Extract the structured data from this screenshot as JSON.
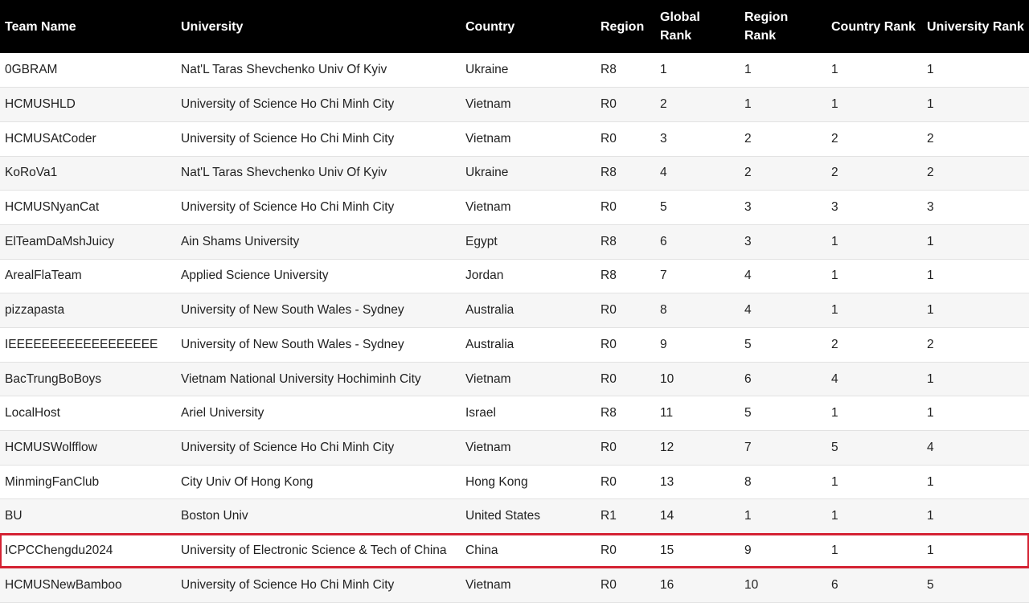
{
  "columns": {
    "team_name": "Team Name",
    "university": "University",
    "country": "Country",
    "region": "Region",
    "global_rank": "Global Rank",
    "region_rank": "Region Rank",
    "country_rank": "Country Rank",
    "university_rank": "University Rank"
  },
  "highlight_color": "#d42233",
  "highlighted_row_index": 14,
  "rows": [
    {
      "team": "0GBRAM",
      "university": "Nat'L Taras Shevchenko Univ Of Kyiv",
      "country": "Ukraine",
      "region": "R8",
      "global_rank": "1",
      "region_rank": "1",
      "country_rank": "1",
      "university_rank": "1"
    },
    {
      "team": "HCMUSHLD",
      "university": "University of Science Ho Chi Minh City",
      "country": "Vietnam",
      "region": "R0",
      "global_rank": "2",
      "region_rank": "1",
      "country_rank": "1",
      "university_rank": "1"
    },
    {
      "team": "HCMUSAtCoder",
      "university": "University of Science Ho Chi Minh City",
      "country": "Vietnam",
      "region": "R0",
      "global_rank": "3",
      "region_rank": "2",
      "country_rank": "2",
      "university_rank": "2"
    },
    {
      "team": "KoRoVa1",
      "university": "Nat'L Taras Shevchenko Univ Of Kyiv",
      "country": "Ukraine",
      "region": "R8",
      "global_rank": "4",
      "region_rank": "2",
      "country_rank": "2",
      "university_rank": "2"
    },
    {
      "team": "HCMUSNyanCat",
      "university": "University of Science Ho Chi Minh City",
      "country": "Vietnam",
      "region": "R0",
      "global_rank": "5",
      "region_rank": "3",
      "country_rank": "3",
      "university_rank": "3"
    },
    {
      "team": "ElTeamDaMshJuicy",
      "university": "Ain Shams University",
      "country": "Egypt",
      "region": "R8",
      "global_rank": "6",
      "region_rank": "3",
      "country_rank": "1",
      "university_rank": "1"
    },
    {
      "team": "ArealFlaTeam",
      "university": "Applied Science University",
      "country": "Jordan",
      "region": "R8",
      "global_rank": "7",
      "region_rank": "4",
      "country_rank": "1",
      "university_rank": "1"
    },
    {
      "team": "pizzapasta",
      "university": "University of New South Wales - Sydney",
      "country": "Australia",
      "region": "R0",
      "global_rank": "8",
      "region_rank": "4",
      "country_rank": "1",
      "university_rank": "1"
    },
    {
      "team": "IEEEEEEEEEEEEEEEEEE",
      "university": "University of New South Wales - Sydney",
      "country": "Australia",
      "region": "R0",
      "global_rank": "9",
      "region_rank": "5",
      "country_rank": "2",
      "university_rank": "2"
    },
    {
      "team": "BacTrungBoBoys",
      "university": "Vietnam National University Hochiminh City",
      "country": "Vietnam",
      "region": "R0",
      "global_rank": "10",
      "region_rank": "6",
      "country_rank": "4",
      "university_rank": "1"
    },
    {
      "team": "LocalHost",
      "university": "Ariel University",
      "country": "Israel",
      "region": "R8",
      "global_rank": "11",
      "region_rank": "5",
      "country_rank": "1",
      "university_rank": "1"
    },
    {
      "team": "HCMUSWolfflow",
      "university": "University of Science Ho Chi Minh City",
      "country": "Vietnam",
      "region": "R0",
      "global_rank": "12",
      "region_rank": "7",
      "country_rank": "5",
      "university_rank": "4"
    },
    {
      "team": "MinmingFanClub",
      "university": "City Univ Of Hong Kong",
      "country": "Hong Kong",
      "region": "R0",
      "global_rank": "13",
      "region_rank": "8",
      "country_rank": "1",
      "university_rank": "1"
    },
    {
      "team": "BU",
      "university": "Boston Univ",
      "country": "United States",
      "region": "R1",
      "global_rank": "14",
      "region_rank": "1",
      "country_rank": "1",
      "university_rank": "1"
    },
    {
      "team": "ICPCChengdu2024",
      "university": "University of Electronic Science & Tech of China",
      "country": "China",
      "region": "R0",
      "global_rank": "15",
      "region_rank": "9",
      "country_rank": "1",
      "university_rank": "1"
    },
    {
      "team": "HCMUSNewBamboo",
      "university": "University of Science Ho Chi Minh City",
      "country": "Vietnam",
      "region": "R0",
      "global_rank": "16",
      "region_rank": "10",
      "country_rank": "6",
      "university_rank": "5"
    }
  ]
}
